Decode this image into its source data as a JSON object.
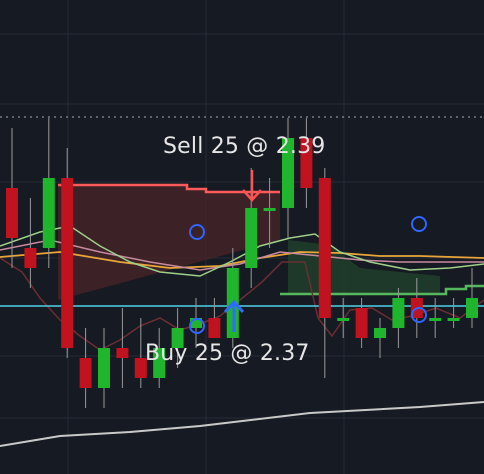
{
  "trades": {
    "sell_label": "Sell 25 @ 2.39",
    "buy_label": "Buy 25 @ 2.37"
  },
  "colors": {
    "background": "#161a22",
    "grid": "#262b36",
    "up_candle": "#1fb52d",
    "down_candle": "#c1121f",
    "stop_line": "#ff5a5a",
    "stop_fill": "#4a2428",
    "trail_line": "#55b85c",
    "trail_fill": "#20402a",
    "cyan_line": "#4fd1e8",
    "orange_ma": "#e8a53a",
    "green_ma": "#9fd08a",
    "pink_ma": "#c98aa0",
    "sell_arrow": "#ff5252",
    "buy_arrow": "#2f6bff",
    "marker": "#2f66ff",
    "lower_line": "#c9c9c9",
    "band_line": "#6a2e33"
  },
  "icons": {
    "sell": "down-arrow-icon",
    "buy": "up-arrow-icon",
    "marker": "circle-icon"
  },
  "chart_data": {
    "type": "candlestick",
    "y_scale": "price",
    "candles": [
      {
        "o": 2.386,
        "h": 2.392,
        "l": 2.378,
        "c": 2.381
      },
      {
        "o": 2.38,
        "h": 2.385,
        "l": 2.376,
        "c": 2.378
      },
      {
        "o": 2.38,
        "h": 2.393,
        "l": 2.378,
        "c": 2.387
      },
      {
        "o": 2.387,
        "h": 2.39,
        "l": 2.369,
        "c": 2.37
      },
      {
        "o": 2.369,
        "h": 2.372,
        "l": 2.364,
        "c": 2.366
      },
      {
        "o": 2.366,
        "h": 2.372,
        "l": 2.364,
        "c": 2.37
      },
      {
        "o": 2.37,
        "h": 2.374,
        "l": 2.366,
        "c": 2.369
      },
      {
        "o": 2.369,
        "h": 2.373,
        "l": 2.366,
        "c": 2.367
      },
      {
        "o": 2.367,
        "h": 2.372,
        "l": 2.366,
        "c": 2.37
      },
      {
        "o": 2.37,
        "h": 2.374,
        "l": 2.368,
        "c": 2.372
      },
      {
        "o": 2.372,
        "h": 2.375,
        "l": 2.37,
        "c": 2.373
      },
      {
        "o": 2.373,
        "h": 2.375,
        "l": 2.371,
        "c": 2.371
      },
      {
        "o": 2.371,
        "h": 2.38,
        "l": 2.37,
        "c": 2.378
      },
      {
        "o": 2.378,
        "h": 2.388,
        "l": 2.376,
        "c": 2.384
      },
      {
        "o": 2.384,
        "h": 2.387,
        "l": 2.38,
        "c": 2.384
      },
      {
        "o": 2.384,
        "h": 2.393,
        "l": 2.381,
        "c": 2.391
      },
      {
        "o": 2.391,
        "h": 2.393,
        "l": 2.384,
        "c": 2.386
      },
      {
        "o": 2.387,
        "h": 2.388,
        "l": 2.367,
        "c": 2.373
      },
      {
        "o": 2.373,
        "h": 2.375,
        "l": 2.371,
        "c": 2.373
      },
      {
        "o": 2.374,
        "h": 2.375,
        "l": 2.37,
        "c": 2.371
      },
      {
        "o": 2.371,
        "h": 2.373,
        "l": 2.369,
        "c": 2.372
      },
      {
        "o": 2.372,
        "h": 2.376,
        "l": 2.37,
        "c": 2.375
      },
      {
        "o": 2.375,
        "h": 2.377,
        "l": 2.371,
        "c": 2.373
      },
      {
        "o": 2.373,
        "h": 2.375,
        "l": 2.371,
        "c": 2.373
      },
      {
        "o": 2.373,
        "h": 2.375,
        "l": 2.372,
        "c": 2.373
      },
      {
        "o": 2.373,
        "h": 2.378,
        "l": 2.372,
        "c": 2.375
      }
    ],
    "trades": [
      {
        "side": "sell",
        "qty": 25,
        "price": 2.39
      },
      {
        "side": "buy",
        "qty": 25,
        "price": 2.37
      }
    ]
  }
}
